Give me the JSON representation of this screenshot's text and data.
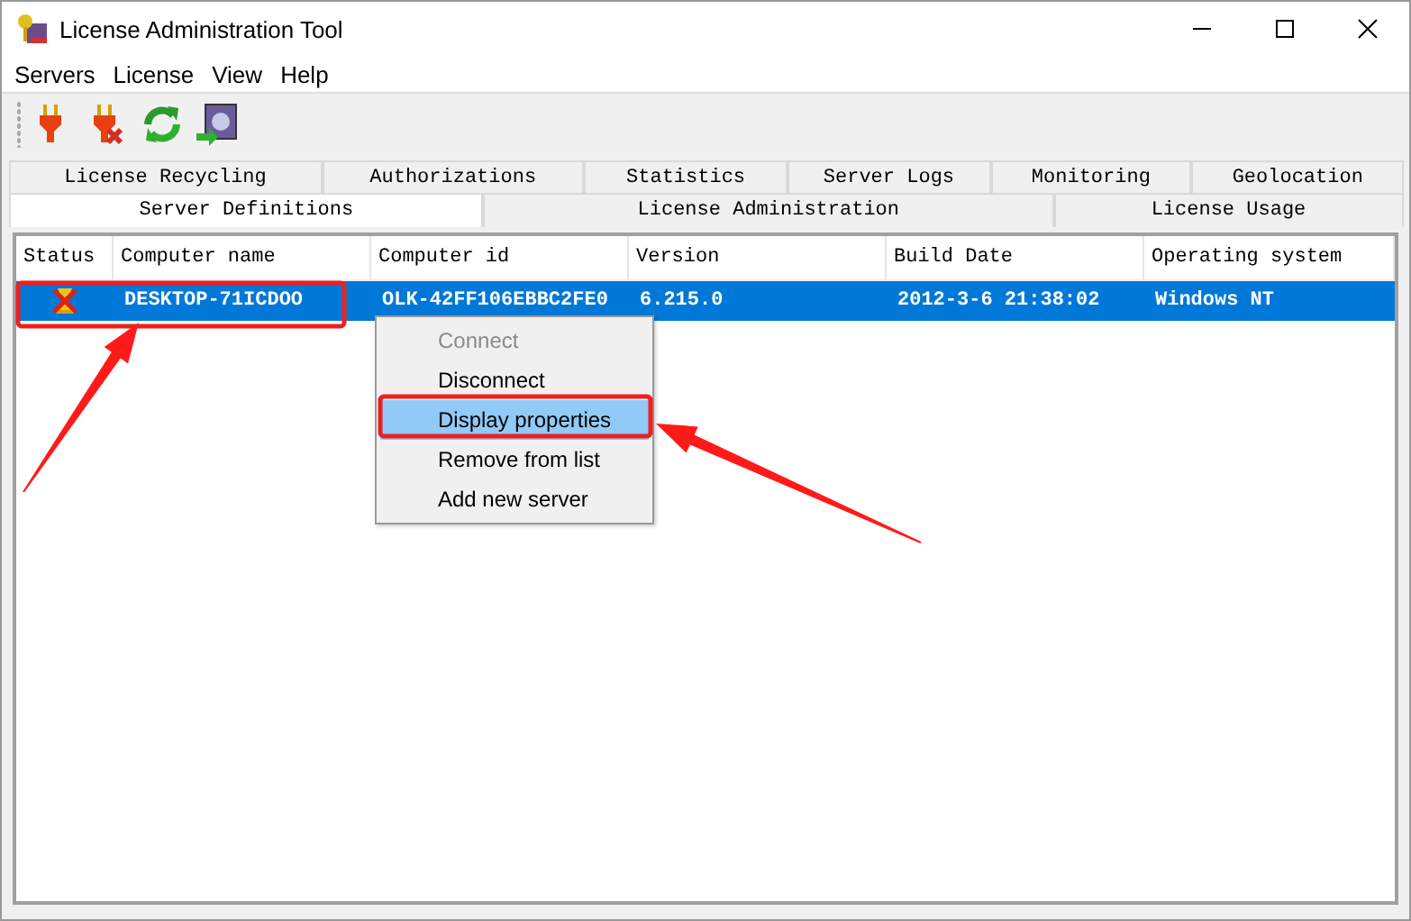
{
  "window": {
    "title": "License Administration Tool"
  },
  "menu_bar": [
    "Servers",
    "License",
    "View",
    "Help"
  ],
  "toolbar": [
    {
      "kind": "plug"
    },
    {
      "kind": "unplug"
    },
    {
      "kind": "refresh"
    },
    {
      "kind": "safe"
    }
  ],
  "tab_rows": [
    [
      {
        "label": "License Recycling",
        "selected": false
      },
      {
        "label": "Authorizations",
        "selected": false
      },
      {
        "label": "Statistics",
        "selected": false
      },
      {
        "label": "Server Logs",
        "selected": false
      },
      {
        "label": "Monitoring",
        "selected": false
      },
      {
        "label": "Geolocation",
        "selected": false
      }
    ],
    [
      {
        "label": "Server Definitions",
        "selected": true
      },
      {
        "label": "License Administration",
        "selected": false
      },
      {
        "label": "License Usage",
        "selected": false
      }
    ]
  ],
  "table": {
    "columns": [
      "Status",
      "Computer name",
      "Computer id",
      "Version",
      "Build Date",
      "Operating system"
    ],
    "rows": [
      {
        "selected": true,
        "cells": [
          "",
          "DESKTOP-71ICDOO",
          "OLK-42FF106EBBC2FE0",
          "6.215.0",
          "2012-3-6 21:38:02",
          "Windows NT"
        ]
      }
    ]
  },
  "context_menu": [
    {
      "label": "Connect",
      "disabled": true,
      "selected": false
    },
    {
      "label": "Disconnect",
      "disabled": false,
      "selected": false
    },
    {
      "label": "Display properties",
      "disabled": false,
      "selected": true
    },
    {
      "label": "Remove from list",
      "disabled": false,
      "selected": false
    },
    {
      "label": "Add new server",
      "disabled": false,
      "selected": false
    }
  ]
}
